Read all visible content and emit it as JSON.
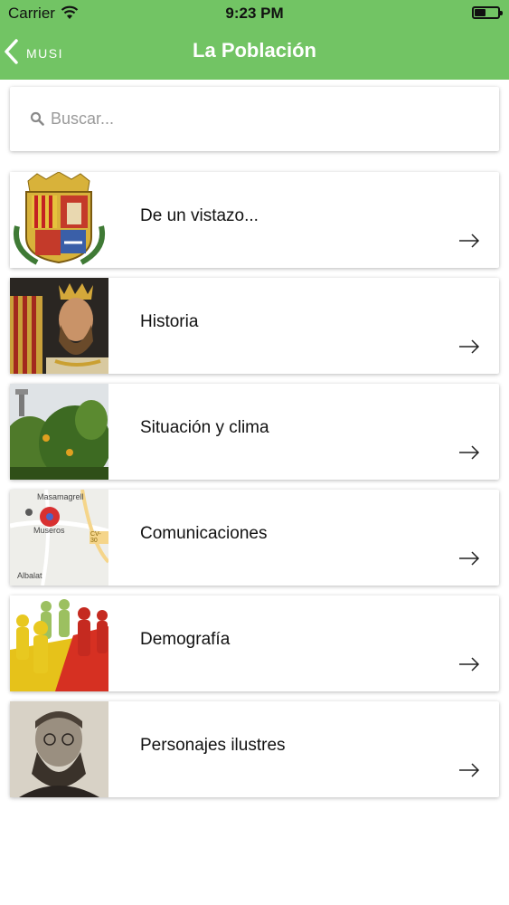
{
  "status_bar": {
    "carrier": "Carrier",
    "time": "9:23 PM"
  },
  "nav": {
    "back_label": "MUSI",
    "title": "La Población"
  },
  "search": {
    "placeholder": "Buscar..."
  },
  "items": [
    {
      "label": "De un vistazo...",
      "image": "coat-of-arms"
    },
    {
      "label": "Historia",
      "image": "king-portrait"
    },
    {
      "label": "Situación y clima",
      "image": "landscape-photo"
    },
    {
      "label": "Comunicaciones",
      "image": "map",
      "map_labels": {
        "top": "Masamagrell",
        "center": "Museros",
        "road": "CV-30",
        "bottom": "Albalat"
      }
    },
    {
      "label": "Demografía",
      "image": "people-figures"
    },
    {
      "label": "Personajes ilustres",
      "image": "man-portrait"
    }
  ],
  "colors": {
    "header_green": "#72c464",
    "text": "#111111",
    "placeholder": "#9a9a9a"
  }
}
